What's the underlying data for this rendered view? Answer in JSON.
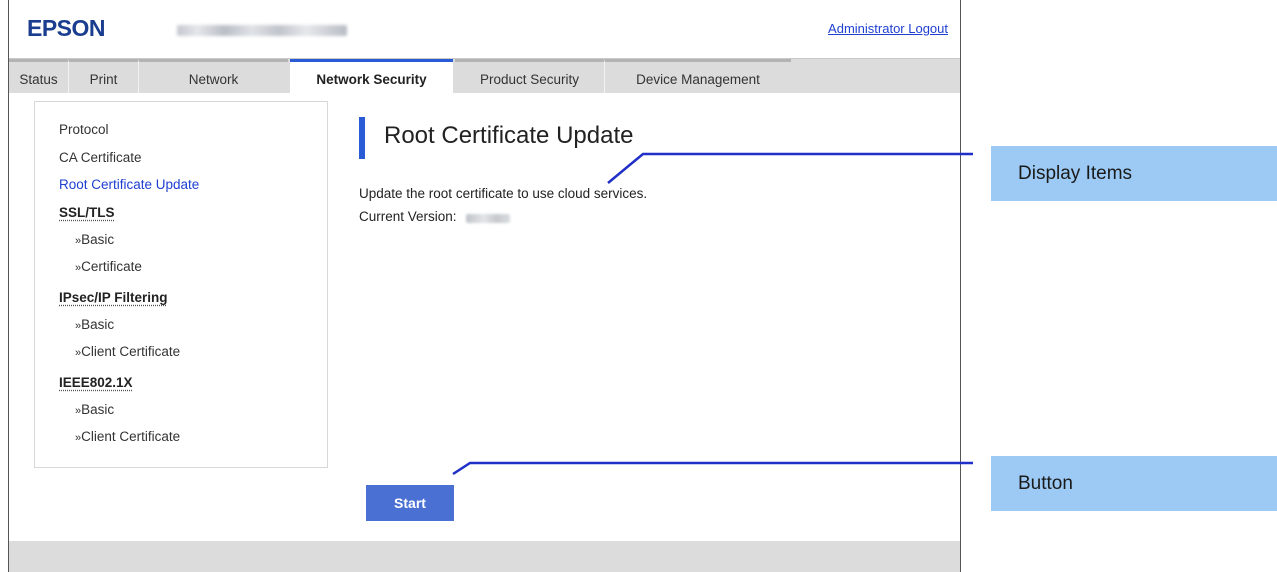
{
  "header": {
    "logo_text": "EPSON",
    "logout_link": "Administrator Logout"
  },
  "tabs": [
    {
      "label": "Status",
      "active": false
    },
    {
      "label": "Print",
      "active": false
    },
    {
      "label": "Network",
      "active": false
    },
    {
      "label": "Network Security",
      "active": true
    },
    {
      "label": "Product Security",
      "active": false
    },
    {
      "label": "Device Management",
      "active": false
    }
  ],
  "sidebar": {
    "items": [
      {
        "label": "Protocol"
      },
      {
        "label": "CA Certificate"
      },
      {
        "label": "Root Certificate Update",
        "current": true
      }
    ],
    "sections": [
      {
        "title": "SSL/TLS",
        "items": [
          "Basic",
          "Certificate"
        ]
      },
      {
        "title": "IPsec/IP Filtering",
        "items": [
          "Basic",
          "Client Certificate"
        ]
      },
      {
        "title": "IEEE802.1X",
        "items": [
          "Basic",
          "Client Certificate"
        ]
      }
    ]
  },
  "main": {
    "title": "Root Certificate Update",
    "description": "Update the root certificate to use cloud services.",
    "version_label": "Current Version:",
    "start_button": "Start"
  },
  "callouts": {
    "display_items": "Display Items",
    "button": "Button"
  },
  "colors": {
    "accent": "#2a5bd7",
    "button": "#4a70d4",
    "callout_bg": "#9ccaf5",
    "link": "#1f3fd0",
    "brand": "#1a3d8f"
  }
}
